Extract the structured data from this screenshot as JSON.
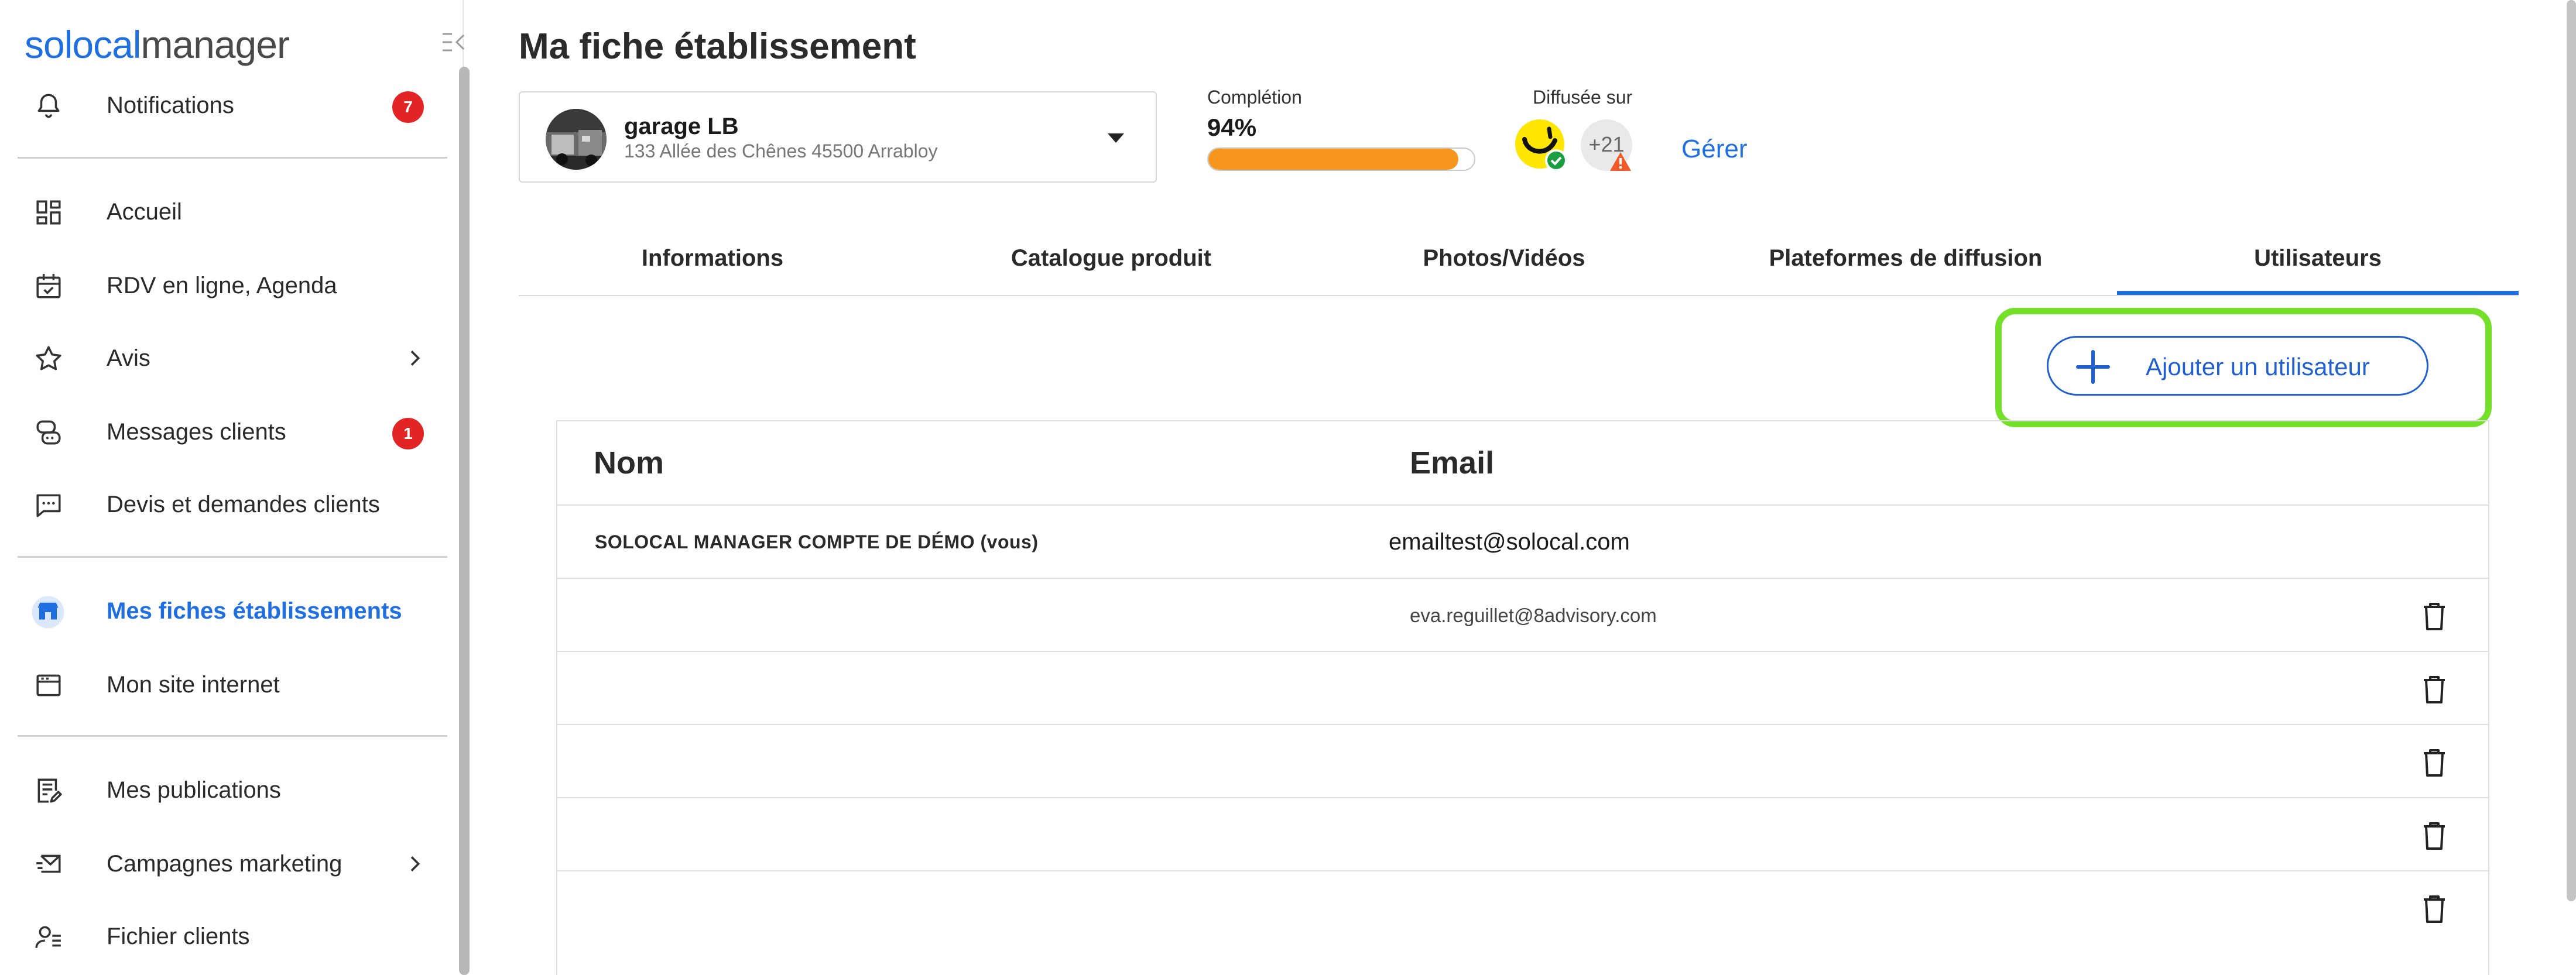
{
  "sidebar": {
    "logo": {
      "part1": "solocal",
      "part2": "manager"
    },
    "items": [
      {
        "label": "Notifications",
        "icon": "bell-icon",
        "badge": "7"
      },
      {
        "label": "Accueil",
        "icon": "dashboard-icon"
      },
      {
        "label": "RDV en ligne, Agenda",
        "icon": "calendar-check-icon"
      },
      {
        "label": "Avis",
        "icon": "star-icon",
        "has_submenu": true
      },
      {
        "label": "Messages clients",
        "icon": "chat-bubbles-icon",
        "badge": "1"
      },
      {
        "label": "Devis et demandes clients",
        "icon": "message-dots-icon"
      },
      {
        "label": "Mes fiches établissements",
        "icon": "store-icon",
        "active": true
      },
      {
        "label": "Mon site internet",
        "icon": "browser-window-icon"
      },
      {
        "label": "Mes publications",
        "icon": "edit-document-icon"
      },
      {
        "label": "Campagnes marketing",
        "icon": "mail-send-icon",
        "has_submenu": true
      },
      {
        "label": "Fichier clients",
        "icon": "users-list-icon"
      }
    ]
  },
  "header": {
    "title": "Ma fiche établissement"
  },
  "establishment": {
    "name": "garage LB",
    "address": "133 Allée des Chênes 45500 Arrabloy"
  },
  "completion": {
    "label": "Complétion",
    "value": "94%",
    "progress": 0.94,
    "color": "#f7961d"
  },
  "diffusion": {
    "label": "Diffusée sur",
    "more_count": "+21",
    "manage_label": "Gérer"
  },
  "tabs": [
    {
      "label": "Informations"
    },
    {
      "label": "Catalogue produit"
    },
    {
      "label": "Photos/Vidéos"
    },
    {
      "label": "Plateformes de diffusion"
    },
    {
      "label": "Utilisateurs",
      "active": true
    }
  ],
  "add_user_button": {
    "label": "Ajouter un utilisateur"
  },
  "users_table": {
    "columns": [
      "Nom",
      "Email"
    ],
    "rows": [
      {
        "name": "SOLOCAL MANAGER COMPTE DE DÉMO (vous)",
        "email": "emailtest@solocal.com",
        "deletable": false
      },
      {
        "name": "",
        "email": "eva.reguillet@8advisory.com",
        "deletable": true
      },
      {
        "name": "",
        "email": "",
        "deletable": true
      },
      {
        "name": "",
        "email": "",
        "deletable": true
      },
      {
        "name": "",
        "email": "",
        "deletable": true
      },
      {
        "name": "",
        "email": "",
        "deletable": true
      }
    ]
  },
  "colors": {
    "accent": "#1f6fe0",
    "badge": "#e32424",
    "highlight": "#74e02a",
    "progress": "#f7961d"
  }
}
